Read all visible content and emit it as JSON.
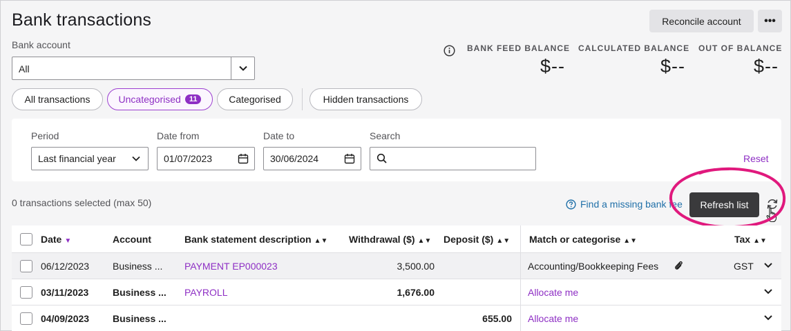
{
  "page": {
    "title": "Bank transactions",
    "reconcile_label": "Reconcile account",
    "more_label": "•••"
  },
  "bank_account": {
    "label": "Bank account",
    "value": "All"
  },
  "balances": [
    {
      "label": "BANK FEED BALANCE",
      "value": "$--"
    },
    {
      "label": "CALCULATED BALANCE",
      "value": "$--"
    },
    {
      "label": "OUT OF BALANCE",
      "value": "$--"
    }
  ],
  "filters": {
    "all": "All transactions",
    "uncategorised": "Uncategorised",
    "uncategorised_count": "11",
    "categorised": "Categorised",
    "hidden": "Hidden transactions"
  },
  "filter_panel": {
    "period_label": "Period",
    "period_value": "Last financial year",
    "date_from_label": "Date from",
    "date_from_value": "01/07/2023",
    "date_to_label": "Date to",
    "date_to_value": "30/06/2024",
    "search_label": "Search",
    "search_value": "",
    "reset_label": "Reset"
  },
  "selection": {
    "count_text": "0 transactions selected (max 50)",
    "find_missing": "Find a missing bank fee",
    "refresh_tooltip": "Refresh list"
  },
  "table": {
    "headers": {
      "date": "Date",
      "account": "Account",
      "description": "Bank statement description",
      "withdrawal": "Withdrawal ($)",
      "deposit": "Deposit ($)",
      "match": "Match or categorise",
      "tax": "Tax"
    },
    "rows": [
      {
        "date": "06/12/2023",
        "account": "Business ...",
        "description": "PAYMENT EP000023",
        "withdrawal": "3,500.00",
        "deposit": "",
        "match": "Accounting/Bookkeeping Fees",
        "tax": "GST"
      },
      {
        "date": "03/11/2023",
        "account": "Business ...",
        "description": "PAYROLL",
        "withdrawal": "1,676.00",
        "deposit": "",
        "match": "Allocate me",
        "tax": ""
      },
      {
        "date": "04/09/2023",
        "account": "Business ...",
        "description": "",
        "withdrawal": "",
        "deposit": "655.00",
        "match": "Allocate me",
        "tax": ""
      }
    ]
  },
  "colors": {
    "accent": "#8e2fc4",
    "link": "#1f6fa8",
    "highlight": "#e0197d"
  }
}
